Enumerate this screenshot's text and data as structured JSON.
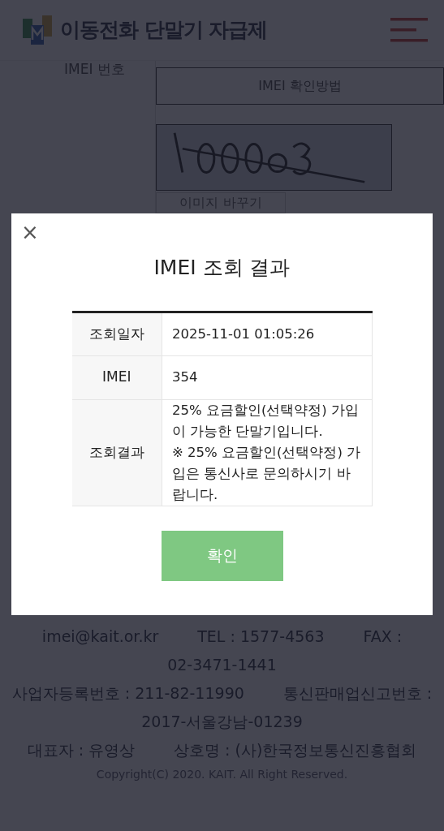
{
  "header": {
    "logo_text": "이동전화 단말기 자급제"
  },
  "form": {
    "imei_label": "IMEI 번호",
    "imei_help_button": "IMEI 확인방법",
    "captcha_change_button": "이미지 바꾸기"
  },
  "footer": {
    "lines": [
      [
        "imei@kait.or.kr",
        "TEL : 1577-4563",
        "FAX :"
      ],
      [
        "02-3471-1441"
      ],
      [
        "사업자등록번호 : 211-82-11990",
        "통신판매업신고번호 :"
      ],
      [
        "2017-서울강남-01239"
      ],
      [
        "대표자 : 유영상",
        "상호명 : (사)한국정보통신진흥협회"
      ]
    ],
    "copyright": "Copyright(C) 2020. KAIT. All Right Reserved."
  },
  "modal": {
    "close": "×",
    "title": "IMEI 조회 결과",
    "rows": [
      {
        "label": "조회일자",
        "value": "2025-11-01 01:05:26"
      },
      {
        "label": "IMEI",
        "value": "354"
      },
      {
        "label": "조회결과",
        "value": "25% 요금할인(선택약정) 가입이 가능한 단말기입니다.\n※ 25% 요금할인(선택약정) 가입은 통신사로 문의하시기 바랍니다."
      }
    ],
    "confirm_button": "확인"
  }
}
